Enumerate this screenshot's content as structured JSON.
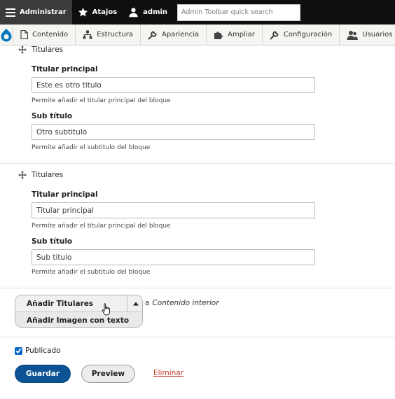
{
  "toolbar": {
    "administrar_label": "Administrar",
    "atajos_label": "Atajos",
    "user_label": "admin",
    "search_placeholder": "Admin Toolbar quick search"
  },
  "tray": {
    "items": [
      {
        "label": "Contenido",
        "icon": "file-icon"
      },
      {
        "label": "Estructura",
        "icon": "sitemap-icon"
      },
      {
        "label": "Apariencia",
        "icon": "wrench-icon"
      },
      {
        "label": "Ampliar",
        "icon": "puzzle-icon"
      },
      {
        "label": "Configuración",
        "icon": "wrench-icon"
      },
      {
        "label": "Usuarios",
        "icon": "users-icon"
      }
    ]
  },
  "blocks": [
    {
      "heading": "Titulares",
      "fields": [
        {
          "label": "Titular principal",
          "value": "Este es otro titulo",
          "description": "Permite añadir el titular principal del bloque"
        },
        {
          "label": "Sub título",
          "value": "Otro subtitulo",
          "description": "Permite añadir el subtitulo del bloque"
        }
      ]
    },
    {
      "heading": "Titulares",
      "fields": [
        {
          "label": "Titular principal",
          "value": "Titular principal",
          "description": "Permite añadir el titular principal del bloque"
        },
        {
          "label": "Sub título",
          "value": "Sub titulo",
          "description": "Permite añadir el subtitulo del bloque"
        }
      ]
    }
  ],
  "add": {
    "primary_label": "Añadir Titulares",
    "secondary_label": "Añadir Imagen con texto",
    "suffix_prefix": "a",
    "suffix_target": "Contenido interior"
  },
  "actions": {
    "published_label": "Publicado",
    "published_checked": true,
    "save_label": "Guardar",
    "preview_label": "Preview",
    "delete_label": "Eliminar"
  },
  "colors": {
    "toolbar_bg": "#0f0f10",
    "primary_button": "#0b5394",
    "delete_link": "#c0392b"
  }
}
